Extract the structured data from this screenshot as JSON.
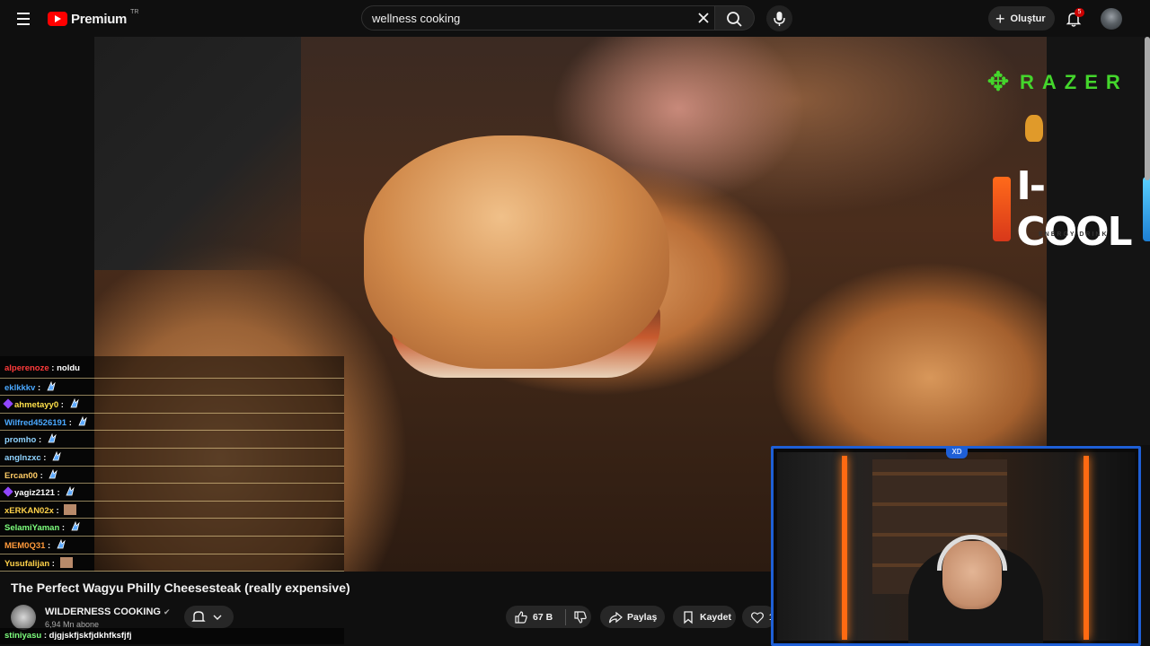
{
  "header": {
    "brand": "Premium",
    "country": "TR",
    "search_value": "wellness cooking",
    "create_label": "Oluştur",
    "notification_count": "5"
  },
  "ads": {
    "razer": "RAZER",
    "icool": "I-COOL",
    "icool_sub": "ENERGY DRINK"
  },
  "chat": {
    "messages": [
      {
        "user": "alperenoze",
        "text": "noldu",
        "color": "#ff3b3b",
        "badge": false,
        "twitch": false
      },
      {
        "user": "eklkkkv",
        "text": "",
        "color": "#4aa8ff",
        "badge": true,
        "twitch": false
      },
      {
        "user": "ahmetayy0",
        "text": "",
        "color": "#ffe14a",
        "badge": true,
        "twitch": true
      },
      {
        "user": "Wilfred4526191",
        "text": "",
        "color": "#4aa8ff",
        "badge": true,
        "twitch": false
      },
      {
        "user": "promho",
        "text": "",
        "color": "#8fd3ff",
        "badge": true,
        "twitch": false
      },
      {
        "user": "anglnzxc",
        "text": "",
        "color": "#8fd3ff",
        "badge": true,
        "twitch": false
      },
      {
        "user": "Ercan00",
        "text": "",
        "color": "#ffcc66",
        "badge": true,
        "twitch": false
      },
      {
        "user": "yagiz2121",
        "text": "",
        "color": "#ffffff",
        "badge": true,
        "twitch": true
      },
      {
        "user": "xERKAN02x",
        "text": "",
        "color": "#ffd24a",
        "badge": false,
        "twitch": false,
        "pfp": true
      },
      {
        "user": "SelamiYaman",
        "text": "",
        "color": "#7dff7d",
        "badge": true,
        "twitch": false
      },
      {
        "user": "MEM0Q31",
        "text": "",
        "color": "#ff9a3b",
        "badge": true,
        "twitch": false
      },
      {
        "user": "Yusufalijan",
        "text": "",
        "color": "#ffd24a",
        "badge": false,
        "twitch": false,
        "pfp": true
      }
    ],
    "last_message": {
      "user": "stiniyasu",
      "text": "djgjskfjskfjdkhfksfjfj",
      "color": "#7dff7d"
    }
  },
  "video": {
    "title": "The Perfect Wagyu Philly Cheesesteak (really expensive)",
    "channel": "WILDERNESS COOKING",
    "subscribers": "6,94 Mn abone",
    "likes": "67 B",
    "share_label": "Paylaş",
    "save_label": "Kaydet",
    "thanks_label": "1"
  },
  "colors": {
    "background": "#0f0f0f",
    "accent_red": "#ff0000",
    "razer_green": "#44d62c",
    "webcam_border": "#1e5fd6",
    "neon_orange": "#ff6a12"
  }
}
